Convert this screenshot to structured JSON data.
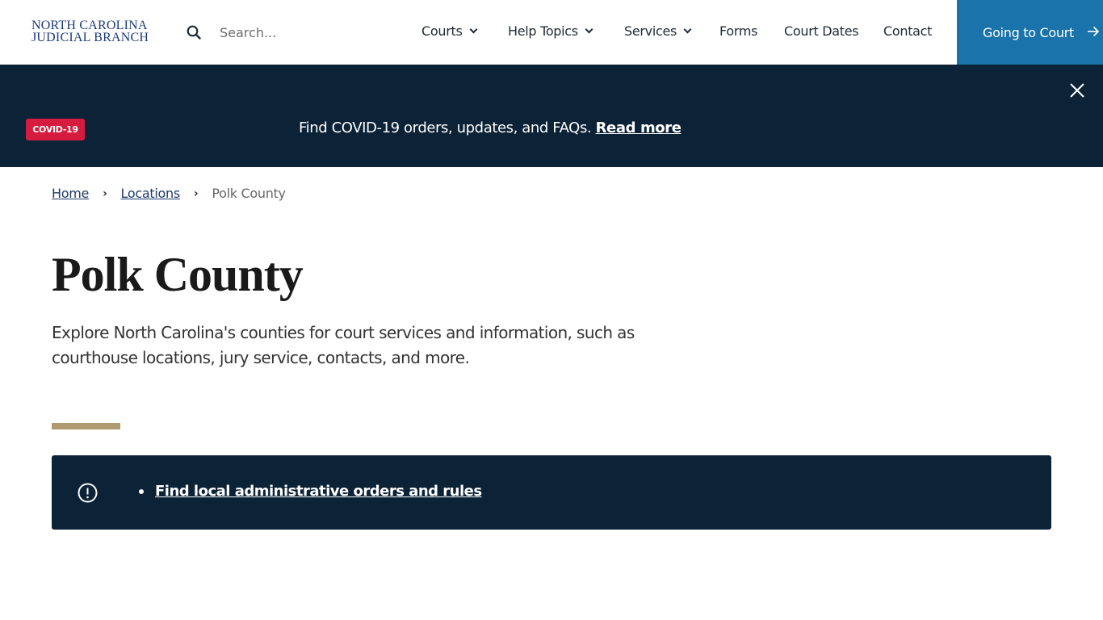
{
  "header": {
    "logo_line1": "NORTH CAROLINA",
    "logo_line2": "JUDICIAL BRANCH",
    "search_placeholder": "Search...",
    "nav": [
      {
        "label": "Courts",
        "has_dropdown": true
      },
      {
        "label": "Help Topics",
        "has_dropdown": true
      },
      {
        "label": "Services",
        "has_dropdown": true
      },
      {
        "label": "Forms",
        "has_dropdown": false
      },
      {
        "label": "Court Dates",
        "has_dropdown": false
      },
      {
        "label": "Contact",
        "has_dropdown": false
      }
    ],
    "cta_label": "Going to Court",
    "cta_icon": "arrow-right-icon",
    "cta_color": "#1a73aa"
  },
  "banner": {
    "badge": "COVID-19",
    "badge_color": "#d51c3e",
    "text": "Find COVID-19 orders, updates, and FAQs.",
    "link": "Read more",
    "background": "#0b2237"
  },
  "breadcrumb": {
    "items": [
      {
        "label": "Home"
      },
      {
        "label": "Locations"
      }
    ],
    "current": "Polk County"
  },
  "main": {
    "title": "Polk County",
    "description": "Explore North Carolina's counties for court services and information, such as courthouse locations, jury service, contacts, and more.",
    "accent_color": "#b09a70",
    "alert": {
      "icon": "exclamation-circle-icon",
      "links": [
        {
          "label": "Find local administrative orders and rules"
        }
      ]
    }
  }
}
